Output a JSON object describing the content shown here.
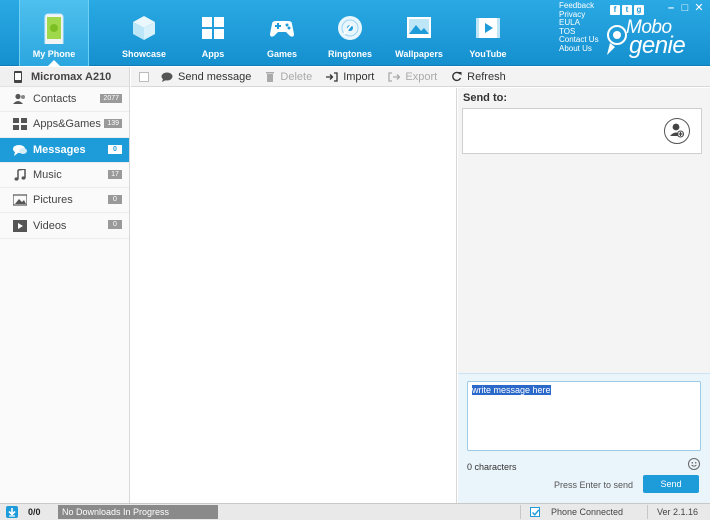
{
  "nav": {
    "items": [
      {
        "label": "My Phone",
        "icon": "android-phone-icon"
      },
      {
        "label": "Showcase",
        "icon": "cube-icon"
      },
      {
        "label": "Apps",
        "icon": "apps-grid-icon"
      },
      {
        "label": "Games",
        "icon": "gamepad-icon"
      },
      {
        "label": "Ringtones",
        "icon": "disc-icon"
      },
      {
        "label": "Wallpapers",
        "icon": "picture-icon"
      },
      {
        "label": "YouTube",
        "icon": "video-icon"
      }
    ],
    "links": [
      "Feedback",
      "Privacy",
      "EULA",
      "TOS",
      "Contact Us",
      "About Us"
    ],
    "social": [
      "f",
      "t",
      "g"
    ],
    "logo": {
      "line1": "Mobo",
      "line2": "genie"
    }
  },
  "sidebar": {
    "device": "Micromax A210",
    "items": [
      {
        "label": "Contacts",
        "badge": "2077",
        "icon": "contacts-icon"
      },
      {
        "label": "Apps&Games",
        "badge": "139",
        "icon": "apps-icon"
      },
      {
        "label": "Messages",
        "badge": "0",
        "icon": "messages-icon"
      },
      {
        "label": "Music",
        "badge": "17",
        "icon": "music-icon"
      },
      {
        "label": "Pictures",
        "badge": "0",
        "icon": "pictures-icon"
      },
      {
        "label": "Videos",
        "badge": "0",
        "icon": "videos-icon"
      }
    ]
  },
  "toolbar": {
    "send": "Send message",
    "delete": "Delete",
    "import": "Import",
    "export": "Export",
    "refresh": "Refresh"
  },
  "compose": {
    "send_to_label": "Send to:",
    "message_placeholder": "write message here",
    "char_count": "0 characters",
    "hint": "Press Enter to send",
    "send_button": "Send"
  },
  "status": {
    "download_count": "0/0",
    "download_text": "No Downloads In Progress",
    "connection": "Phone Connected",
    "version": "Ver 2.1.16"
  },
  "colors": {
    "accent": "#1e9bd9",
    "topbar": "#1e9bd9"
  }
}
